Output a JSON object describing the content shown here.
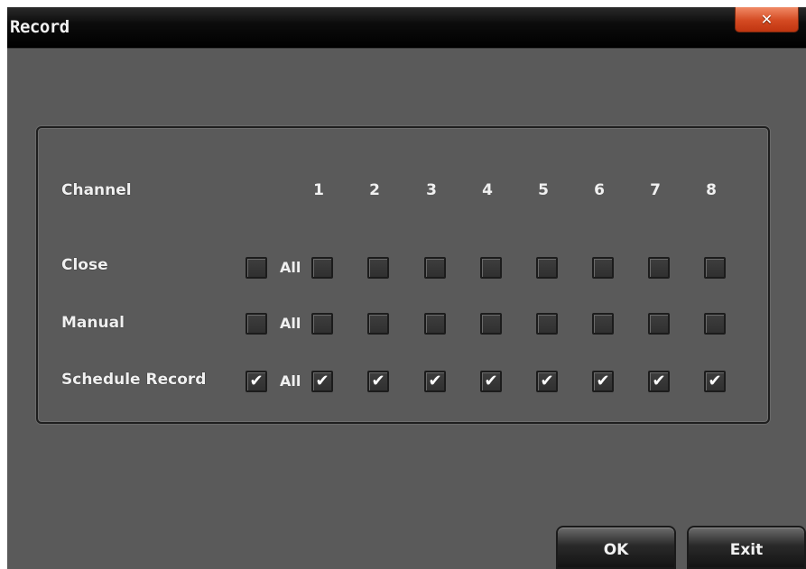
{
  "window": {
    "title": "Record",
    "close_glyph": "✕"
  },
  "grid": {
    "channel_label": "Channel",
    "channels": [
      "1",
      "2",
      "3",
      "4",
      "5",
      "6",
      "7",
      "8"
    ],
    "all_label": "All",
    "rows": [
      {
        "label": "Close",
        "all_checked": false,
        "checked": [
          false,
          false,
          false,
          false,
          false,
          false,
          false,
          false
        ]
      },
      {
        "label": "Manual",
        "all_checked": false,
        "checked": [
          false,
          false,
          false,
          false,
          false,
          false,
          false,
          false
        ]
      },
      {
        "label": "Schedule Record",
        "all_checked": true,
        "checked": [
          true,
          true,
          true,
          true,
          true,
          true,
          true,
          true
        ]
      }
    ]
  },
  "buttons": {
    "ok_label": "OK",
    "exit_label": "Exit"
  },
  "colors": {
    "background": "#5a5a5a",
    "titlebar": "#000000",
    "close_button": "#d44a22"
  }
}
